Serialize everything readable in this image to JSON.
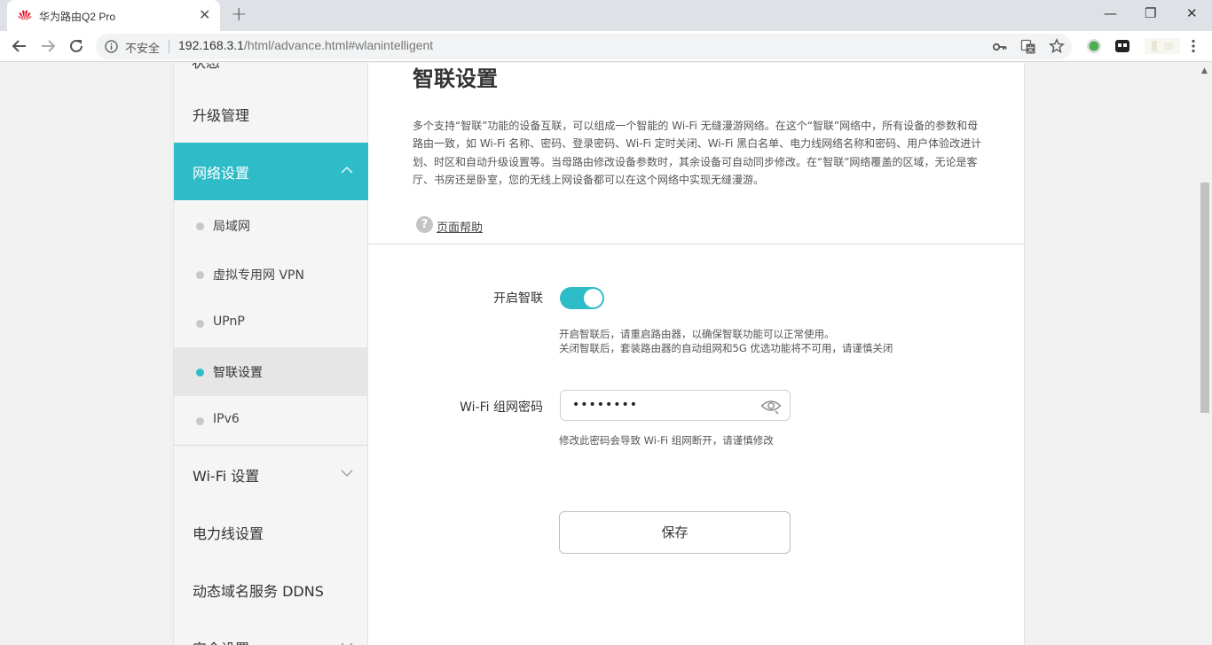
{
  "browser": {
    "tab_title": "华为路由Q2 Pro",
    "tab_close": "✕",
    "new_tab": "+",
    "window_controls": {
      "minimize": "—",
      "restore": "❐",
      "close": "✕"
    },
    "security_label": "不安全",
    "url_host": "192.168.3.1",
    "url_path": "/html/advance.html#wlanintelligent"
  },
  "sidebar": {
    "top_partial": "状态",
    "upgrade": "升级管理",
    "network_settings": "网络设置",
    "sub_items": [
      "局域网",
      "虚拟专用网 VPN",
      "UPnP",
      "智联设置",
      "IPv6"
    ],
    "wifi_settings": "Wi-Fi 设置",
    "powerline": "电力线设置",
    "ddns": "动态域名服务 DDNS",
    "security_partial": "安全设置"
  },
  "main": {
    "title": "智联设置",
    "description": "多个支持“智联”功能的设备互联，可以组成一个智能的 Wi-Fi 无缝漫游网络。在这个“智联”网络中，所有设备的参数和母路由一致，如 Wi-Fi 名称、密码、登录密码、Wi-Fi 定时关闭、Wi-Fi 黑白名单、电力线网络名称和密码、用户体验改进计划、时区和自动升级设置等。当母路由修改设备参数时，其余设备可自动同步修改。在“智联”网络覆盖的区域，无论是客厅、书房还是卧室，您的无线上网设备都可以在这个网络中实现无缝漫游。",
    "help_icon": "?",
    "help_link": "页面帮助",
    "enable_label": "开启智联",
    "enable_state": true,
    "enable_hint_line1": "开启智联后，请重启路由器，以确保智联功能可以正常使用。",
    "enable_hint_line2": "关闭智联后，套装路由器的自动组网和5G 优选功能将不可用，请谨慎关闭",
    "password_label": "Wi-Fi 组网密码",
    "password_value": "••••••••",
    "password_hint": "修改此密码会导致 Wi-Fi 组网断开，请谨慎修改",
    "save_label": "保存"
  },
  "colors": {
    "accent": "#2dbcc8",
    "huawei_red": "#e60012"
  }
}
